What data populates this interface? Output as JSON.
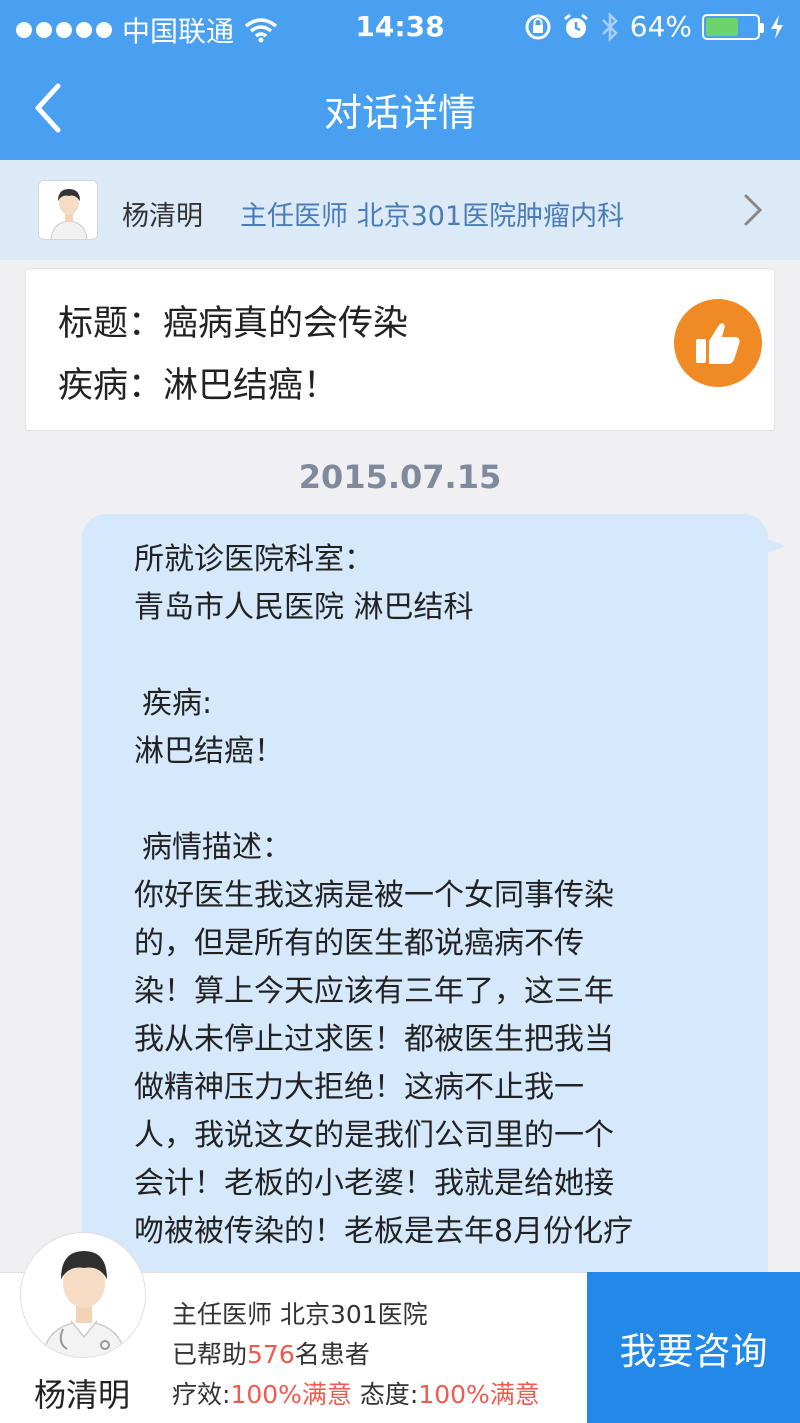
{
  "status_bar": {
    "carrier": "中国联通",
    "time": "14:38",
    "battery_text": "64%",
    "battery_level": 0.64,
    "signal_icon": "signal-dots-icon",
    "wifi_icon": "wifi-icon",
    "icons": [
      "rotation-lock-icon",
      "alarm-icon",
      "bluetooth-icon",
      "charging-icon"
    ]
  },
  "nav": {
    "title": "对话详情",
    "back_icon": "back-chevron-icon"
  },
  "doctor_bar": {
    "name": "杨清明",
    "title": "主任医师 北京301医院肿瘤内科"
  },
  "question_card": {
    "title_line": "标题：癌病真的会传染",
    "disease_line": "疾病：淋巴结癌！",
    "like_icon": "thumbs-up-icon",
    "accent_color": "#f08a24"
  },
  "date": "2015.07.15",
  "message": {
    "hospital_label": "所就诊医院科室：",
    "hospital_value": "青岛市人民医院 淋巴结科",
    "disease_label": "疾病:",
    "disease_value": "淋巴结癌！",
    "desc_label": "病情描述：",
    "desc_lines": [
      "你好医生我这病是被一个女同事传染",
      "的，但是所有的医生都说癌病不传",
      "染！算上今天应该有三年了，这三年",
      "我从未停止过求医！都被医生把我当",
      "做精神压力大拒绝！这病不止我一",
      "人，我说这女的是我们公司里的一个",
      "会计！老板的小老婆！我就是给她接",
      "吻被被传染的！老板是去年8月份化疗"
    ]
  },
  "footer": {
    "doctor_name": "杨清明",
    "title": "主任医师 北京301医院",
    "helped_prefix": "已帮助",
    "helped_count": "576",
    "helped_suffix": "名患者",
    "effect_label": "疗效:",
    "effect_value": "100%满意",
    "attitude_label": "态度:",
    "attitude_value": "100%满意",
    "consult_button": "我要咨询",
    "highlight_color": "#f05a50",
    "button_color": "#2289e8"
  }
}
